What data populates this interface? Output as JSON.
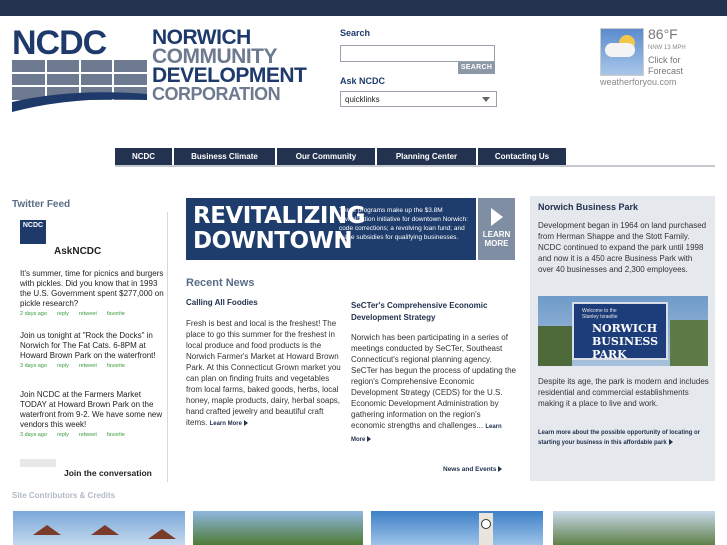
{
  "logo": {
    "acronym": "NCDC",
    "line1": "NORWICH",
    "line2": "COMMUNITY",
    "line3": "DEVELOPMENT",
    "line4": "CORPORATION"
  },
  "search": {
    "label": "Search",
    "value": "",
    "button": "SEARCH"
  },
  "ask": {
    "label": "Ask NCDC",
    "selected": "quicklinks"
  },
  "weather": {
    "temp": "86°F",
    "wind": "NNW 13 MPH",
    "click": "Click for Forecast",
    "site": "weatherforyou.com"
  },
  "nav": [
    {
      "label": "NCDC"
    },
    {
      "label": "Business Climate"
    },
    {
      "label": "Our Community"
    },
    {
      "label": "Planning Center"
    },
    {
      "label": "Contacting Us"
    }
  ],
  "twitter": {
    "title": "Twitter Feed",
    "avatar_text": "NCDC",
    "handle": "AskNCDC",
    "tweets": [
      {
        "text": "It's summer, time for picnics and burgers with pickles. Did you know that in 1993 the U.S. Government spent $277,000 on pickle research?",
        "time": "2 days ago",
        "reply": "reply",
        "retweet": "retweet",
        "favorite": "favorite"
      },
      {
        "text": "Join us tonight at \"Rock the Docks\" in Norwich for The Fat Cats. 6-8PM at Howard Brown Park on the waterfront!",
        "time": "3 days ago",
        "reply": "reply",
        "retweet": "retweet",
        "favorite": "favorite"
      },
      {
        "text": "Join NCDC at the Farmers Market TODAY at Howard Brown Park on the waterfront from 9-2. We have some new vendors this week!",
        "time": "3 days ago",
        "reply": "reply",
        "retweet": "retweet",
        "favorite": "favorite"
      }
    ],
    "join": "Join the conversation"
  },
  "banner": {
    "headline1": "REVITALIZING",
    "headline2": "DOWNTOWN",
    "description": "Three programs make up the $3.8M revitalization initiative for downtown Norwich: code corrections; a revolving loan fund; and lease subsidies for qualifying businesses.",
    "learn1": "LEARN",
    "learn2": "MORE"
  },
  "recent_news": {
    "title": "Recent News",
    "item1": {
      "title": "Calling All Foodies",
      "body": "Fresh is best and local is the freshest! The place to go this summer for the freshest in local produce and food products is the Norwich Farmer's Market at Howard Brown Park. At this Connecticut Grown market you can plan on finding fruits and vegetables from local farms, baked goods, herbs, local honey, maple products, dairy, herbal soaps, hand crafted jewelry and beautiful craft items.",
      "more": "Learn More"
    },
    "item2": {
      "title": "SeCTer's Comprehensive Economic Development Strategy",
      "body": "Norwich has been participating in a series of meetings conducted by SeCTer, Southeast Connecticut's regional planning agency. SeCTer has begun the process of updating the region's Comprehensive Economic Development Strategy (CEDS) for the U.S. Economic Development Administration by gathering information on the region's economic strengths and challenges...",
      "more": "Learn More"
    },
    "news_events": "News and Events"
  },
  "business_park": {
    "title": "Norwich Business Park",
    "body1": "Development began in 1964 on land purchased from Herman Shappe and the Stott Family. NCDC continued to expand the park until 1998 and now it is a 450 acre Business Park with over 40 businesses and 2,300 employees.",
    "sign_small1": "Welcome to the",
    "sign_small2": "Stanley Israelite",
    "sign_line1": "NORWICH",
    "sign_line2": "BUSINESS",
    "sign_line3": "PARK",
    "body2": "Despite its age, the park is modern and includes residential and commercial establishments making it a place to live and work.",
    "more": "Learn more about the possible opportunity of locating or starting your business in this affordable park"
  },
  "footer": {
    "credits": "Site Contributors & Credits"
  }
}
